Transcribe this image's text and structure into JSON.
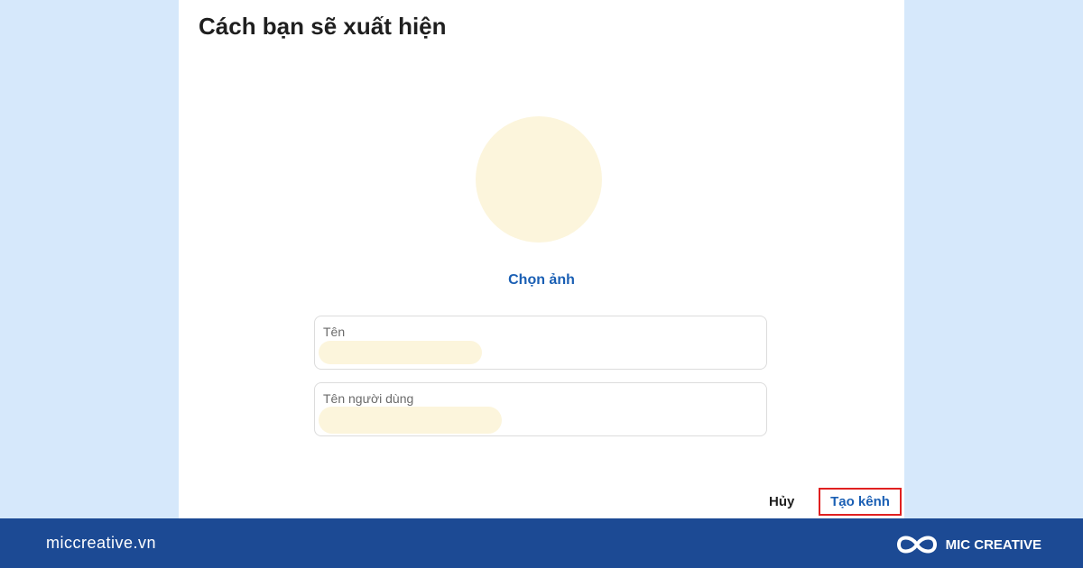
{
  "dialog": {
    "title": "Cách bạn sẽ xuất hiện",
    "choose_photo": "Chọn ảnh",
    "fields": {
      "name_label": "Tên",
      "username_label": "Tên người dùng"
    },
    "actions": {
      "cancel": "Hủy",
      "create": "Tạo kênh"
    }
  },
  "footer": {
    "site": "miccreative.vn",
    "brand": "MIC CREATIVE",
    "logo_icon": "infinity-logo-icon"
  },
  "colors": {
    "background": "#d6e8fb",
    "placeholder_fill": "#fcf5dc",
    "link_blue": "#1a5fb4",
    "highlight_red": "#e02020",
    "footer_blue": "#1c4a94"
  }
}
